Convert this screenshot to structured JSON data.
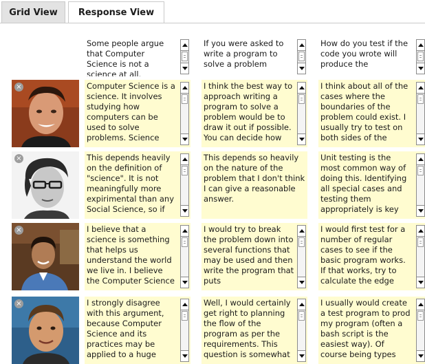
{
  "tabs": [
    {
      "label": "Grid View",
      "active": false
    },
    {
      "label": "Response View",
      "active": true
    }
  ],
  "questions": [
    "Some people argue that Computer Science is not a science at all.",
    "If you were asked to write a program to solve a problem",
    "How do you test if the code you wrote will produce the"
  ],
  "rows": [
    {
      "avatar": "student-1-photo",
      "answers": [
        "Computer Science is a science.  It involves studying how computers can be used to solve problems.  Science",
        "I think the best way to approach writing a program to solve a problem would be to draw it out if possible. You can decide how",
        "I think about all of the cases where the boundaries of the problem could exist. I usually try to test on both sides of the"
      ]
    },
    {
      "avatar": "student-2-photo",
      "answers": [
        "This depends heavily on the definition of \"science\". It is not meaningfully more expirimental than any Social Science, so if",
        "This depends so heavily on the nature of the problem that I don't think I can give a reasonable answer.",
        "Unit testing is the most common way of doing this. Identifying all special cases and testing them appropriately is key"
      ]
    },
    {
      "avatar": "student-3-photo",
      "answers": [
        "I believe that a science is something that helps us understand the world we live in. I believe the Computer Science",
        "I would try to break the problem down into several functions that may be used and then write the program that puts",
        "I would first test for a number of regular cases to see if the basic program works. If that works, try to calculate the edge"
      ]
    },
    {
      "avatar": "student-4-photo",
      "answers": [
        "I strongly disagree with this argument, because Computer Science and its practices may be applied to a huge",
        "Well, I would certainly get right to planning the flow of the program as per the requirements. This question is somewhat",
        "I usually would create a test program to prod my program (often a bash script is the easiest way). Of course being types"
      ]
    }
  ],
  "remove_glyph": "×"
}
